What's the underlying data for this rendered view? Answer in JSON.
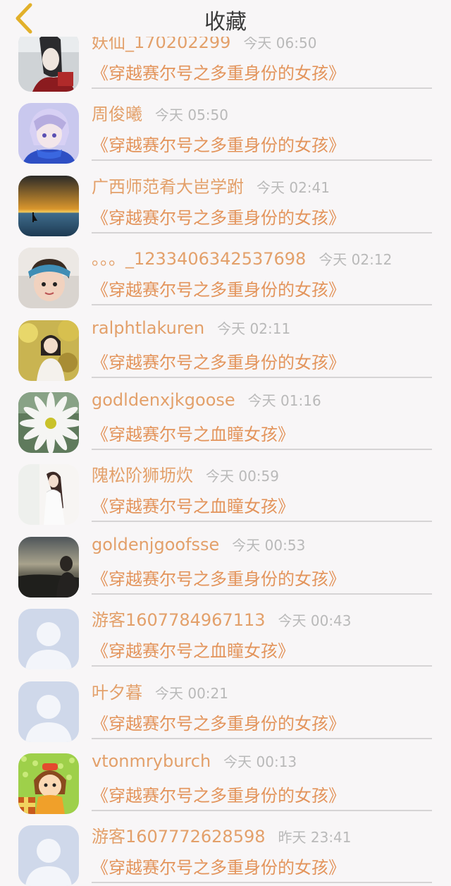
{
  "header": {
    "title": "收藏",
    "back_icon": "chevron-left-icon",
    "accent": "#e2b02a"
  },
  "colors": {
    "name": "#e3a06a",
    "book": "#e3945b",
    "time": "#b9b9b9"
  },
  "favorites": [
    {
      "name": "妖仙_170202299",
      "time": "今天 06:50",
      "book": "《穿越赛尔号之多重身份的女孩》",
      "avatar": "anime-boy"
    },
    {
      "name": "周俊曦",
      "time": "今天 05:50",
      "book": "《穿越赛尔号之多重身份的女孩》",
      "avatar": "anime-purple"
    },
    {
      "name": "广西师范肴大岜学跗",
      "time": "今天 02:41",
      "book": "《穿越赛尔号之多重身份的女孩》",
      "avatar": "sunset-sea"
    },
    {
      "name": "。。。_1233406342537698",
      "time": "今天 02:12",
      "book": "《穿越赛尔号之多重身份的女孩》",
      "avatar": "child-photo"
    },
    {
      "name": "ralphtlakuren",
      "time": "今天 02:11",
      "book": "《穿越赛尔号之多重身份的女孩》",
      "avatar": "girl-autumn"
    },
    {
      "name": "godldenxjkgoose",
      "time": "今天 01:16",
      "book": "《穿越赛尔号之血瞳女孩》",
      "avatar": "white-flower"
    },
    {
      "name": "隗松阶狮坜炊",
      "time": "今天 00:59",
      "book": "《穿越赛尔号之血瞳女孩》",
      "avatar": "girl-white"
    },
    {
      "name": "goldenjgoofsse",
      "time": "今天 00:53",
      "book": "《穿越赛尔号之多重身份的女孩》",
      "avatar": "dusk-man"
    },
    {
      "name": "游客1607784967113",
      "time": "今天 00:43",
      "book": "《穿越赛尔号之血瞳女孩》",
      "avatar": "default-user"
    },
    {
      "name": "叶夕暮",
      "time": "今天 00:21",
      "book": "《穿越赛尔号之多重身份的女孩》",
      "avatar": "default-user"
    },
    {
      "name": "vtonmryburch",
      "time": "今天 00:13",
      "book": "《穿越赛尔号之多重身份的女孩》",
      "avatar": "cartoon-girl"
    },
    {
      "name": "游客1607772628598",
      "time": "昨天 23:41",
      "book": "《穿越赛尔号之多重身份的女孩》",
      "avatar": "default-user"
    }
  ]
}
